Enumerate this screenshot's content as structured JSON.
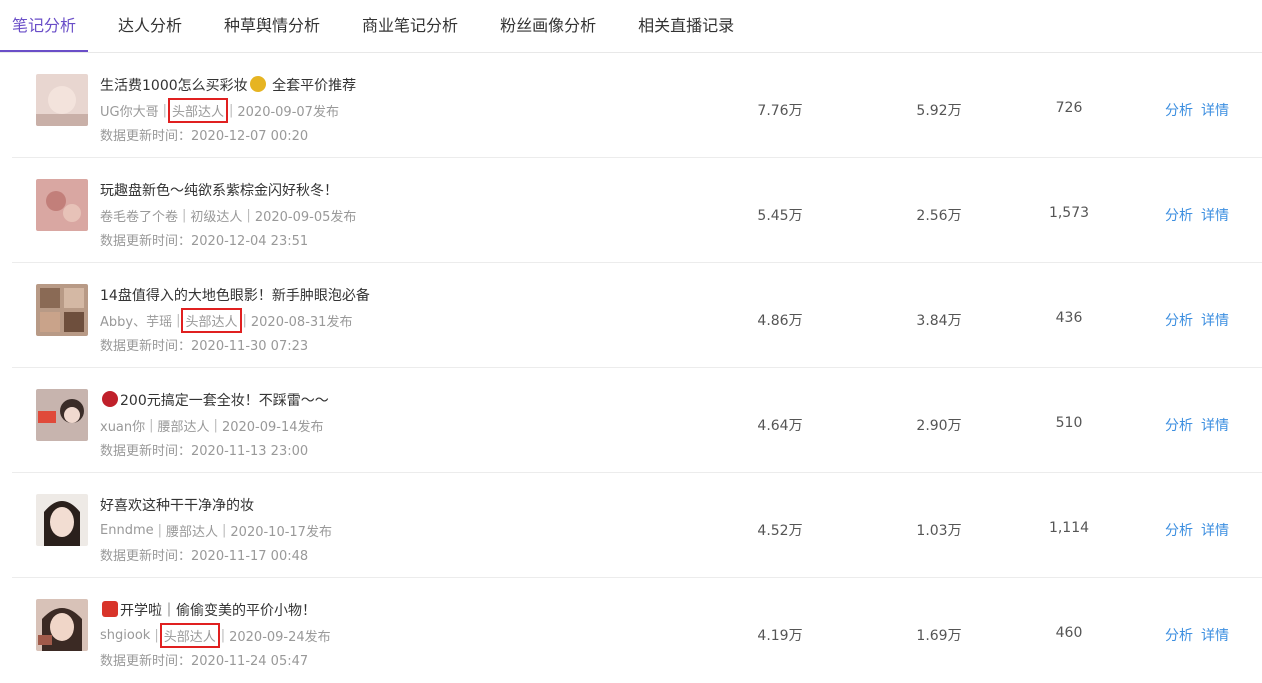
{
  "tabs": [
    "笔记分析",
    "达人分析",
    "种草舆情分析",
    "商业笔记分析",
    "粉丝画像分析",
    "相关直播记录"
  ],
  "actions": {
    "analyze": "分析",
    "detail": "详情"
  },
  "rows": [
    {
      "title_pre": "生活费1000怎么买彩妆",
      "title_post": " 全套平价推荐",
      "emoji": "money-bag-icon",
      "author": "UG你大哥",
      "tag": "头部达人",
      "tag_highlight": true,
      "publish": "2020-09-07发布",
      "update": "数据更新时间：2020-12-07 00:20",
      "v1": "7.76万",
      "v2": "5.92万",
      "v3": "726"
    },
    {
      "title_pre": "玩趣盘新色～纯欲系紫棕金闪好秋冬！",
      "title_post": "",
      "emoji": "",
      "author": "卷毛卷了个卷",
      "tag": "初级达人",
      "tag_highlight": false,
      "publish": "2020-09-05发布",
      "update": "数据更新时间：2020-12-04 23:51",
      "v1": "5.45万",
      "v2": "2.56万",
      "v3": "1,573"
    },
    {
      "title_pre": "14盘值得入的大地色眼影！新手肿眼泡必备",
      "title_post": "",
      "emoji": "",
      "author": "Abby、芋瑶",
      "tag": "头部达人",
      "tag_highlight": true,
      "publish": "2020-08-31发布",
      "update": "数据更新时间：2020-11-30 07:23",
      "v1": "4.86万",
      "v2": "3.84万",
      "v3": "436"
    },
    {
      "title_pre": "",
      "title_post": "200元搞定一套全妆！不踩雷～～",
      "emoji": "cherries-icon",
      "author": "xuan你",
      "tag": "腰部达人",
      "tag_highlight": false,
      "publish": "2020-09-14发布",
      "update": "数据更新时间：2020-11-13 23:00",
      "v1": "4.64万",
      "v2": "2.90万",
      "v3": "510"
    },
    {
      "title_pre": "好喜欢这种干干净净的妆",
      "title_post": "",
      "emoji": "",
      "author": "Enndme",
      "tag": "腰部达人",
      "tag_highlight": false,
      "publish": "2020-10-17发布",
      "update": "数据更新时间：2020-11-17 00:48",
      "v1": "4.52万",
      "v2": "1.03万",
      "v3": "1,114"
    },
    {
      "title_pre": "",
      "title_post": "开学啦｜偷偷变美的平价小物！",
      "emoji": "red-badge-icon",
      "author": "shgiook",
      "tag": "头部达人",
      "tag_highlight": true,
      "publish": "2020-09-24发布",
      "update": "数据更新时间：2020-11-24 05:47",
      "v1": "4.19万",
      "v2": "1.69万",
      "v3": "460"
    }
  ],
  "colors": {
    "accent": "#6a4ec8",
    "link": "#3d8fe0",
    "highlight_box": "#e02020"
  }
}
